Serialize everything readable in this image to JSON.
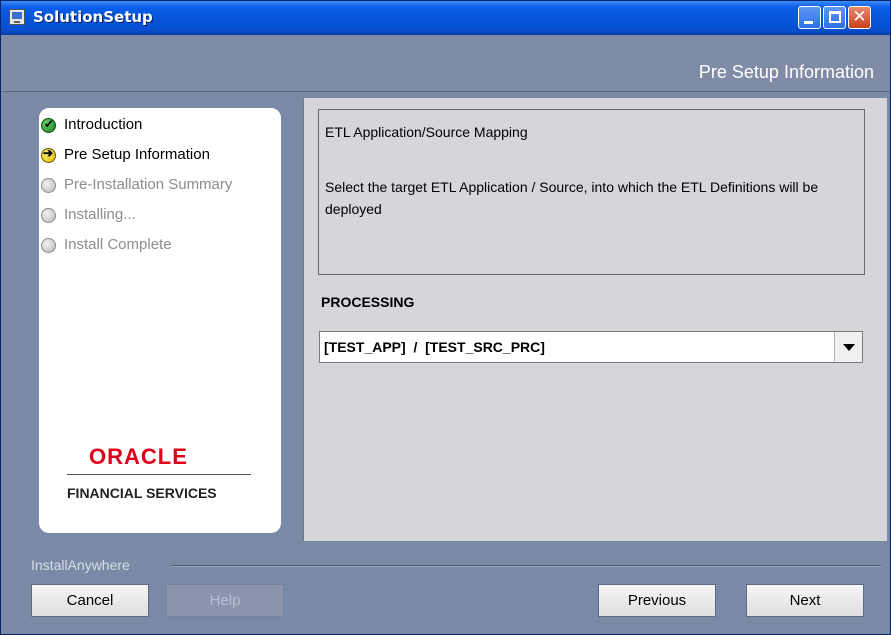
{
  "window": {
    "title": "SolutionSetup"
  },
  "header": {
    "step_title": "Pre Setup Information"
  },
  "steps": [
    {
      "label": "Introduction",
      "state": "complete"
    },
    {
      "label": "Pre Setup Information",
      "state": "current"
    },
    {
      "label": "Pre-Installation Summary",
      "state": "pending"
    },
    {
      "label": "Installing...",
      "state": "pending"
    },
    {
      "label": "Install Complete",
      "state": "pending"
    }
  ],
  "branding": {
    "logo_text": "ORACLE",
    "subtitle": "FINANCIAL SERVICES"
  },
  "content": {
    "heading": "ETL Application/Source Mapping",
    "description": "Select the target ETL Application / Source, into which the ETL Definitions will be deployed",
    "processing_label": "PROCESSING",
    "processing_selected": "[TEST_APP]  /  [TEST_SRC_PRC]"
  },
  "footer": {
    "installer_label": "InstallAnywhere",
    "cancel_label": "Cancel",
    "help_label": "Help",
    "previous_label": "Previous",
    "next_label": "Next"
  },
  "icons": {
    "complete": "checkmark-icon",
    "current": "arrow-right-icon",
    "pending": "gray-circle-icon"
  },
  "colors": {
    "title_bar": "#0654d9",
    "frame": "#7a8aa6",
    "oracle_red": "#e0001a"
  }
}
